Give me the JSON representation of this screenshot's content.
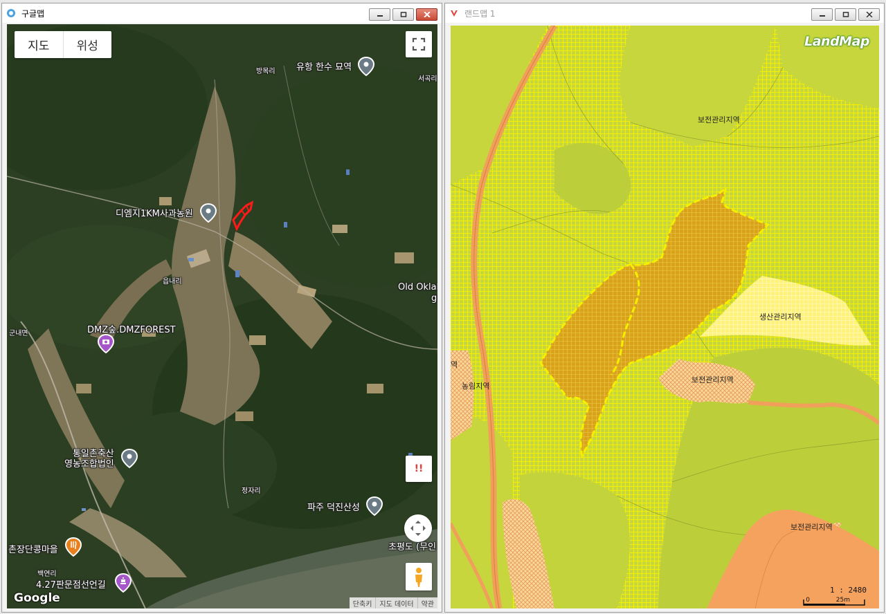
{
  "left_window": {
    "title": "구글맵",
    "map_type": {
      "map_label": "지도",
      "satellite_label": "위성"
    },
    "places": {
      "yuhang": "유항 한수 묘역",
      "bangmok": "방목리",
      "seogok": "서곡리",
      "dmz_apple": "디엠지1KM사과농원",
      "eupnae": "읍내리",
      "old_okla_1": "Old Oklah",
      "old_okla_2": "gu",
      "gunnae": "군내면",
      "dmz_forest": "DMZ숲.DMZFOREST",
      "tongil_1": "통일촌축산",
      "tongil_2": "영농조합법인",
      "jeongja": "정자리",
      "deokjin": "파주 덕진산성",
      "chopyeong": "초평도 (무인",
      "chonjang": "촌장단콩마을",
      "baegyeon": "백연리",
      "pan427": "4.27판문점선언길"
    },
    "report_label": "!!",
    "google_logo": "Google",
    "attribution": {
      "shortcuts": "단축키",
      "map_data": "지도 데이터",
      "terms": "약관"
    },
    "icons": {
      "fullscreen": "fullscreen-icon",
      "nav": "navigation-icon",
      "pegman": "pegman-icon"
    },
    "colors": {
      "boundary": "#ff1a1a",
      "pin_gray": "#6b7b86",
      "pin_purple": "#a557c9",
      "pin_orange": "#e8801e"
    }
  },
  "right_window": {
    "title": "랜드맵 1",
    "logo": "LandMap",
    "zones": {
      "conservation_top": "보전관리지역",
      "production": "생산관리지역",
      "conservation_mid": "보전관리지역",
      "agri_forest": "농림지역",
      "agri_forest_edge": "역",
      "conservation_bottom": "보전관리지역"
    },
    "scale": {
      "ratio": "1 : 2480",
      "zero": "0",
      "distance": "25m"
    },
    "colors": {
      "base_green": "#c6d63c",
      "hatch": "#f4f000",
      "parcel": "#d9a21a",
      "road": "#f0a05a",
      "production": "#fff27a"
    }
  }
}
